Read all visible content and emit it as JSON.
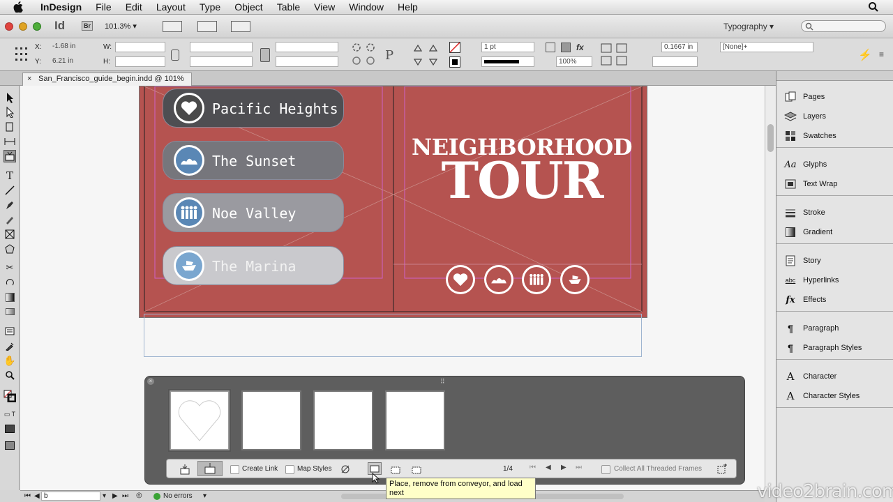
{
  "menubar": {
    "app_name": "InDesign",
    "items": [
      "File",
      "Edit",
      "Layout",
      "Type",
      "Object",
      "Table",
      "View",
      "Window",
      "Help"
    ]
  },
  "appbar": {
    "logo": "Id",
    "bridge": "Br",
    "zoom": "101.3%",
    "workspace": "Typography"
  },
  "control": {
    "x_label": "X:",
    "x_value": "-1.68 in",
    "y_label": "Y:",
    "y_value": "6.21 in",
    "w_label": "W:",
    "h_label": "H:",
    "stroke_weight": "1 pt",
    "opacity": "100%",
    "offset": "0.1667 in",
    "object_style": "[None]+"
  },
  "document_tab": {
    "title": "San_Francisco_guide_begin.indd @ 101%"
  },
  "page_content": {
    "buttons": [
      "Pacific Heights",
      "The Sunset",
      "Noe Valley",
      "The Marina"
    ],
    "heading_line1": "NEIGHBORHOOD",
    "heading_line2": "TOUR",
    "page_color": "#b55350"
  },
  "panels": {
    "groups": [
      [
        "Pages",
        "Layers",
        "Swatches"
      ],
      [
        "Glyphs",
        "Text Wrap"
      ],
      [
        "Stroke",
        "Gradient"
      ],
      [
        "Story",
        "Hyperlinks",
        "Effects"
      ],
      [
        "Paragraph",
        "Paragraph Styles"
      ],
      [
        "Character",
        "Character Styles"
      ]
    ]
  },
  "conveyor": {
    "create_link": "Create Link",
    "map_styles": "Map Styles",
    "page_counter": "1/4",
    "collect_threaded": "Collect All Threaded Frames"
  },
  "tooltip": "Place, remove from conveyor, and load next",
  "statusbar": {
    "page": "b",
    "errors": "No errors"
  },
  "watermark": "video2brain.com"
}
